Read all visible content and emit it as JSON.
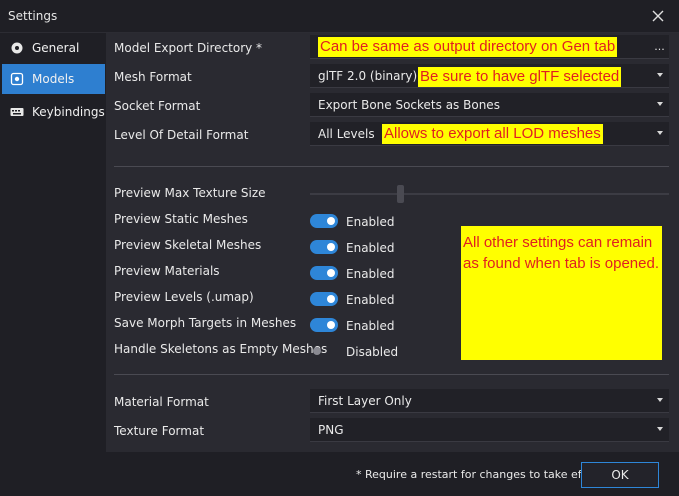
{
  "window": {
    "title": "Settings"
  },
  "sidebar": {
    "items": [
      {
        "label": "General",
        "icon": "gear-icon"
      },
      {
        "label": "Models",
        "icon": "cube-icon",
        "active": true
      },
      {
        "label": "Keybindings",
        "icon": "keyboard-icon"
      }
    ]
  },
  "models": {
    "export_dir_label": "Model Export Directory *",
    "export_dir_value": "",
    "browse_label": "...",
    "mesh_format_label": "Mesh Format",
    "mesh_format_value": "glTF 2.0 (binary)",
    "socket_format_label": "Socket Format",
    "socket_format_value": "Export Bone Sockets as Bones",
    "lod_format_label": "Level Of Detail Format",
    "lod_format_value": "All Levels",
    "preview_tex_label": "Preview Max Texture Size",
    "preview_tex_level": 0.25,
    "toggles": [
      {
        "label": "Preview Static Meshes",
        "state": "Enabled",
        "on": true
      },
      {
        "label": "Preview Skeletal Meshes",
        "state": "Enabled",
        "on": true
      },
      {
        "label": "Preview Materials",
        "state": "Enabled",
        "on": true
      },
      {
        "label": "Preview Levels (.umap)",
        "state": "Enabled",
        "on": true
      },
      {
        "label": "Save Morph Targets in Meshes",
        "state": "Enabled",
        "on": true
      },
      {
        "label": "Handle Skeletons as Empty Meshes",
        "state": "Disabled",
        "on": false
      }
    ],
    "material_format_label": "Material Format",
    "material_format_value": "First Layer Only",
    "texture_format_label": "Texture Format",
    "texture_format_value": "PNG"
  },
  "annotations": {
    "export_dir": "Can be same as output directory on Gen tab",
    "mesh_format": "Be sure to have glTF selected",
    "lod": "Allows to export all LOD meshes",
    "other": "All other settings can remain as found when tab is opened."
  },
  "footer": {
    "note": "* Require a restart for changes to take effect",
    "ok_label": "OK"
  },
  "colors": {
    "accent": "#2e7fd0",
    "annotation_bg": "#ffff00",
    "annotation_text": "#e02020"
  }
}
